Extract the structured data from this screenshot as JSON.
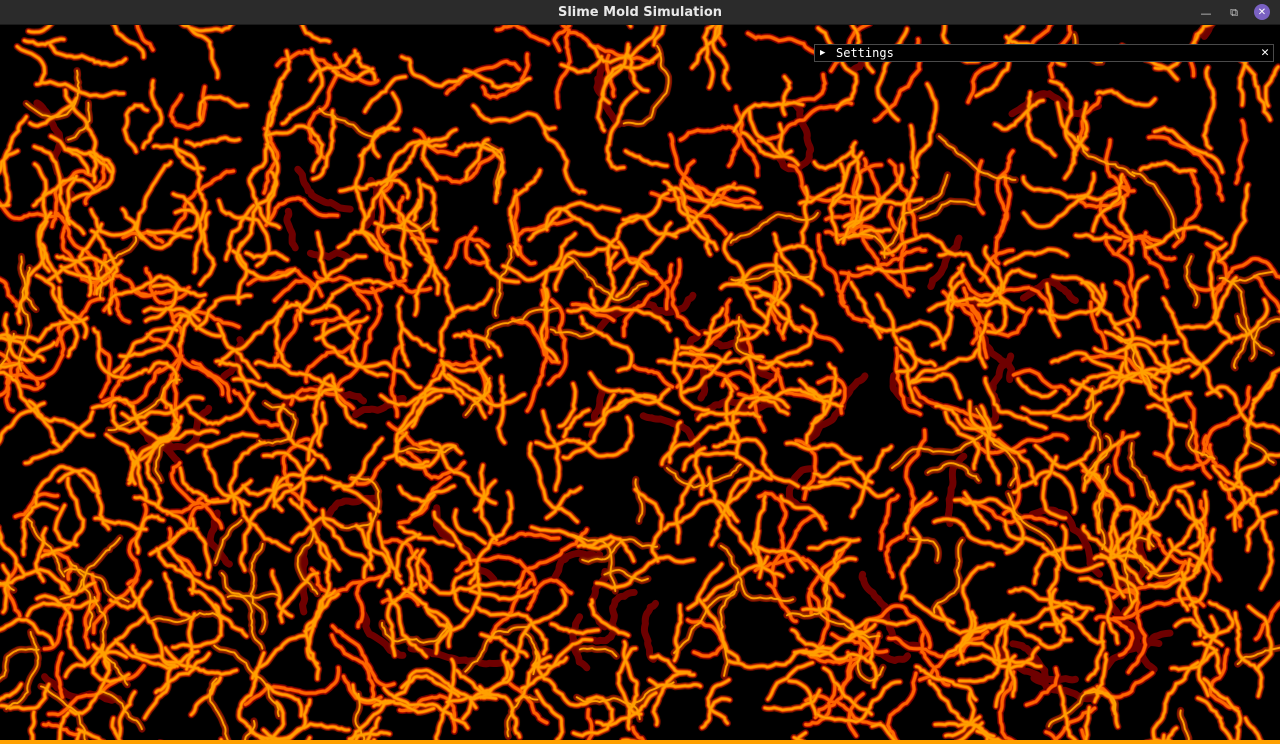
{
  "window": {
    "title": "Slime Mold Simulation",
    "minimize_icon": "minimize-icon",
    "restore_icon": "restore-icon",
    "close_icon": "close-icon"
  },
  "settings_panel": {
    "label": "Settings",
    "collapsed": true,
    "expand_icon": "triangle-right-icon",
    "close_icon": "close-icon"
  },
  "simulation": {
    "background_color": "#000000",
    "trail_colors": [
      "#7a0000",
      "#d42000",
      "#ff6a00",
      "#ffa000"
    ]
  }
}
